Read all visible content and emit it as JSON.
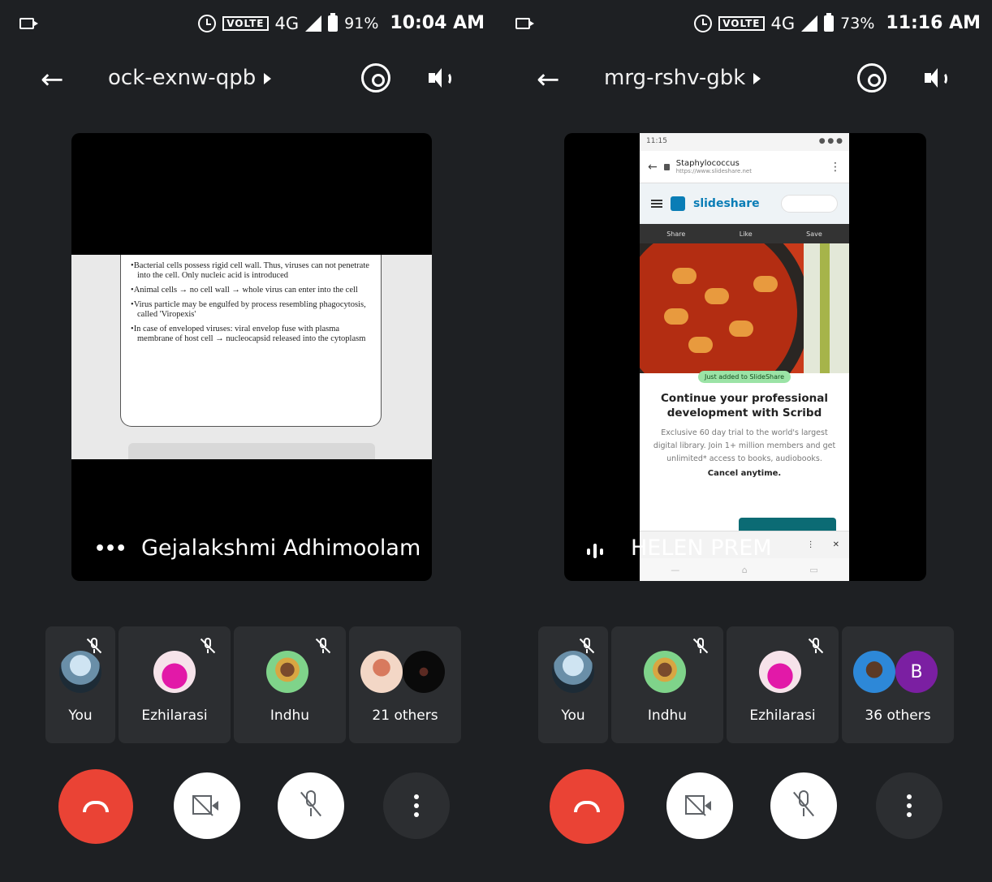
{
  "panels": [
    {
      "status": {
        "volte": "VOLTE",
        "network": "4G",
        "battery": "91%",
        "time": "10:04 AM"
      },
      "header": {
        "meeting_code": "ock-exnw-qpb"
      },
      "tile": {
        "speaker_name": "Gejalakshmi Adhimoolam",
        "slide_bullets": [
          "Bacterial cells possess rigid cell wall. Thus, viruses can not penetrate into the cell. Only nucleic acid is introduced",
          "Animal cells → no cell wall → whole virus can enter into the cell",
          "Virus particle may be engulfed by process resembling phagocytosis, called 'Viropexis'",
          "In case of enveloped viruses: viral envelop fuse with plasma membrane of host cell → nucleocapsid released into the cytoplasm"
        ]
      },
      "participants": [
        {
          "name": "You"
        },
        {
          "name": "Ezhilarasi"
        },
        {
          "name": "Indhu"
        },
        {
          "name": "21 others"
        }
      ]
    },
    {
      "status": {
        "volte": "VOLTE",
        "network": "4G",
        "battery": "73%",
        "time": "11:16 AM"
      },
      "header": {
        "meeting_code": "mrg-rshv-gbk"
      },
      "tile": {
        "speaker_name": "HELEN PREM",
        "phone": {
          "status_time": "11:15",
          "page_title": "Staphylococcus",
          "page_url": "https://www.slideshare.net",
          "logo": "slideshare",
          "action_share": "Share",
          "action_like": "Like",
          "action_save": "Save",
          "badge": "Just added to SlideShare",
          "headline": "Continue your professional development with Scribd",
          "body": "Exclusive 60 day trial to the world's largest digital library. Join 1+ million members and get unlimited* access to books, audiobooks.",
          "cancel": "Cancel anytime."
        }
      },
      "participants": [
        {
          "name": "You"
        },
        {
          "name": "Indhu"
        },
        {
          "name": "Ezhilarasi"
        },
        {
          "name": "36 others",
          "avatar_letter": "B"
        }
      ]
    }
  ]
}
